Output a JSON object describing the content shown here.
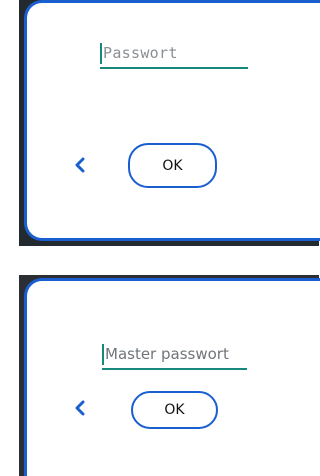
{
  "dialog_top": {
    "password_field": {
      "placeholder": "Passwort",
      "value": ""
    },
    "back_button": {
      "icon": "chevron-left-icon"
    },
    "ok_button": {
      "label": "OK"
    }
  },
  "dialog_bottom": {
    "password_field": {
      "placeholder": "Master passwort",
      "value": ""
    },
    "back_button": {
      "icon": "chevron-left-icon"
    },
    "ok_button": {
      "label": "OK"
    }
  },
  "colors": {
    "accent_blue": "#1a5fd0",
    "field_underline": "#17897c",
    "placeholder_gray": "#8a8f94",
    "frame_dark": "#222a2f"
  }
}
